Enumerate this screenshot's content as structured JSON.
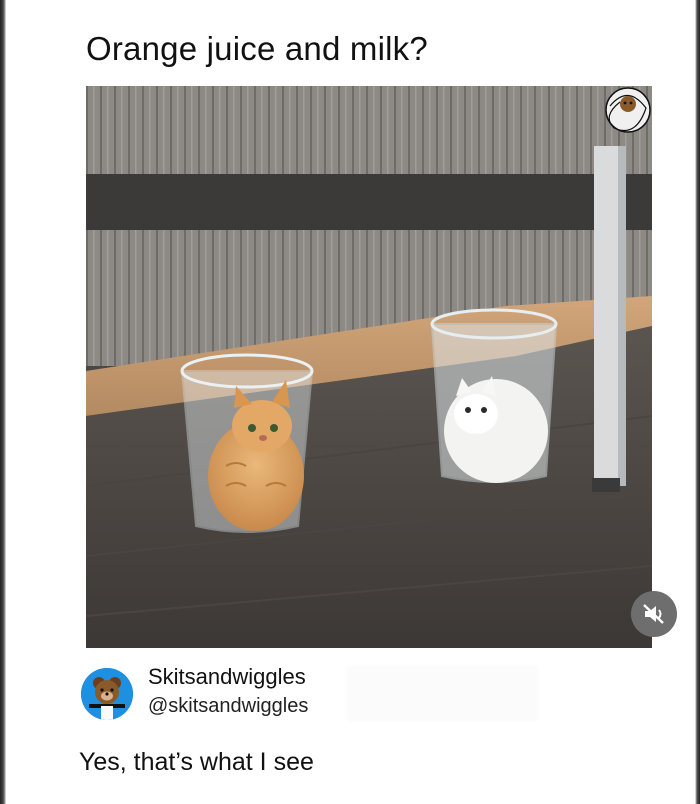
{
  "post": {
    "title": "Orange juice and milk?"
  },
  "media": {
    "image_description": "Two kittens sitting in clear plastic cups",
    "mute_icon": "speaker-muted-icon"
  },
  "reply": {
    "display_name": "Skitsandwiggles",
    "handle": "@skitsandwiggles",
    "text": "Yes, that’s what I see",
    "avatar_color": "#1f8fe0"
  },
  "colors": {
    "page_background": "#ffffff",
    "text": "#111111",
    "mute_button": "#6e6e6e"
  }
}
